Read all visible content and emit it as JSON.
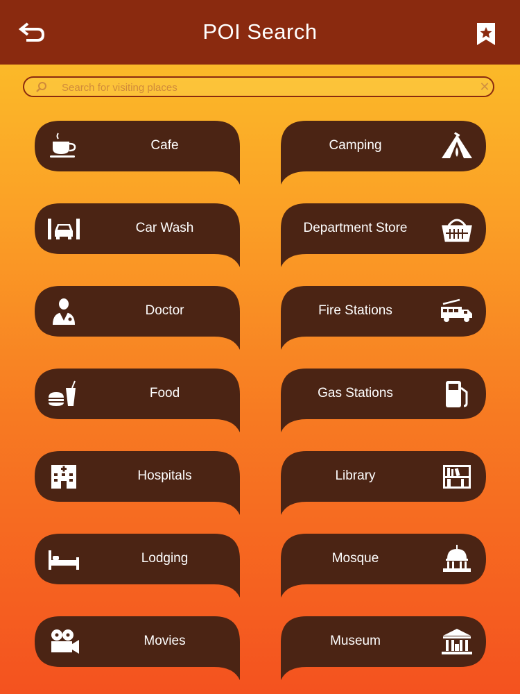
{
  "header": {
    "title": "POI Search",
    "back_icon": "back-arrow-icon",
    "bookmark_icon": "bookmark-star-icon"
  },
  "search": {
    "placeholder": "Search for visiting places",
    "value": ""
  },
  "colors": {
    "header_bg": "#8a2a0f",
    "tile_bg": "#4b2414",
    "gradient_top": "#fbc42a",
    "gradient_bottom": "#f4521f"
  },
  "categories": {
    "left": [
      {
        "label": "Cafe",
        "icon": "coffee-cup-icon"
      },
      {
        "label": "Car Wash",
        "icon": "car-wash-icon"
      },
      {
        "label": "Doctor",
        "icon": "doctor-icon"
      },
      {
        "label": "Food",
        "icon": "burger-drink-icon"
      },
      {
        "label": "Hospitals",
        "icon": "hospital-building-icon"
      },
      {
        "label": "Lodging",
        "icon": "bed-icon"
      },
      {
        "label": "Movies",
        "icon": "movie-camera-icon"
      }
    ],
    "right": [
      {
        "label": "Camping",
        "icon": "tent-icon"
      },
      {
        "label": "Department Store",
        "icon": "shopping-basket-icon"
      },
      {
        "label": "Fire Stations",
        "icon": "fire-truck-icon"
      },
      {
        "label": "Gas Stations",
        "icon": "gas-pump-icon"
      },
      {
        "label": "Library",
        "icon": "bookshelf-icon"
      },
      {
        "label": "Mosque",
        "icon": "dome-icon"
      },
      {
        "label": "Museum",
        "icon": "museum-icon"
      }
    ]
  }
}
